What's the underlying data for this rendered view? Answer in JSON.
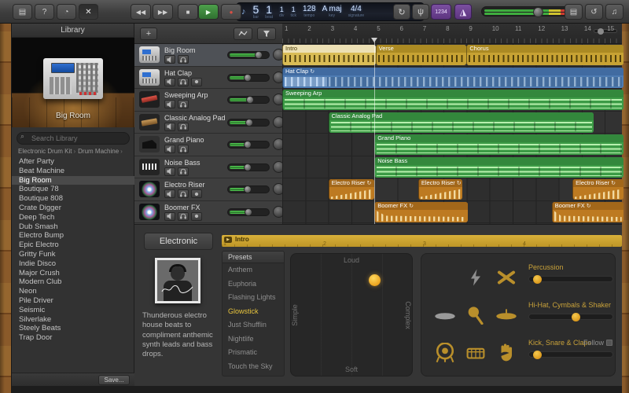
{
  "colors": {
    "accent_yellow": "#e8c53d",
    "region_yellow": "#c7a233",
    "region_blue": "#4e7cb3",
    "region_green": "#3c9b46",
    "region_orange": "#bd7a21",
    "play_green": "#3e8e41",
    "record_red": "#d94f44",
    "countin_purple": "#7b4fa0"
  },
  "toolbar": {
    "left_buttons": [
      {
        "name": "library-toggle-button",
        "glyph": "▤"
      },
      {
        "name": "quick-help-button",
        "glyph": "?"
      },
      {
        "name": "touch-instrument-button",
        "glyph": "◔"
      },
      {
        "name": "smart-controls-button",
        "glyph": "✕",
        "selected": true
      }
    ],
    "transport": {
      "rewind": "◀◀",
      "forward": "▶▶",
      "stop": "■",
      "play": "▶",
      "record": "●"
    },
    "cycle_glyph": "↻",
    "tuner_glyph": "ψ",
    "countin_label": "1234",
    "right_buttons": [
      {
        "name": "notepad-button",
        "glyph": "▤"
      },
      {
        "name": "loop-browser-button",
        "glyph": "↺"
      },
      {
        "name": "media-browser-button",
        "glyph": "♫"
      }
    ],
    "meter_level": 0.62
  },
  "lcd": {
    "icon": "♪",
    "fields": [
      {
        "label": "bar",
        "value": "5",
        "big": true
      },
      {
        "label": "beat",
        "value": "1",
        "big": true
      },
      {
        "label": "div",
        "value": "1"
      },
      {
        "label": "tick",
        "value": "1"
      },
      {
        "label": "tempo",
        "value": "128"
      },
      {
        "label": "key",
        "value": "A maj"
      },
      {
        "label": "signature",
        "value": "4/4"
      }
    ]
  },
  "library": {
    "title": "Library",
    "instrument_name": "Big Room",
    "search_placeholder": "Search Library",
    "breadcrumb": [
      "Electronic Drum Kit",
      "Drum Machine"
    ],
    "items": [
      "After Party",
      "Beat Machine",
      "Big Room",
      "Boutique 78",
      "Boutique 808",
      "Crate Digger",
      "Deep Tech",
      "Dub Smash",
      "Electro Bump",
      "Epic Electro",
      "Gritty Funk",
      "Indie Disco",
      "Major Crush",
      "Modern Club",
      "Neon",
      "Pile Driver",
      "Seismic",
      "Silverlake",
      "Steely Beats",
      "Trap Door"
    ],
    "selected_item": "Big Room",
    "save_label": "Save..."
  },
  "tracks": [
    {
      "name": "Big Room",
      "icon": "drum-machine",
      "selected": true,
      "volume": 0.78,
      "extra_button": false
    },
    {
      "name": "Hat Clap",
      "icon": "drum-machine",
      "selected": false,
      "volume": 0.45,
      "extra_button": true
    },
    {
      "name": "Sweeping Arp",
      "icon": "keyboard-red",
      "selected": false,
      "volume": 0.52,
      "extra_button": false
    },
    {
      "name": "Classic Analog Pad",
      "icon": "keyboard-wood",
      "selected": false,
      "volume": 0.5,
      "extra_button": false
    },
    {
      "name": "Grand Piano",
      "icon": "grand-piano",
      "selected": false,
      "volume": 0.45,
      "extra_button": false
    },
    {
      "name": "Noise Bass",
      "icon": "synth",
      "selected": false,
      "volume": 0.45,
      "extra_button": false
    },
    {
      "name": "Electro Riser",
      "icon": "sparkle",
      "selected": false,
      "volume": 0.45,
      "extra_button": true
    },
    {
      "name": "Boomer FX",
      "icon": "sparkle",
      "selected": false,
      "volume": 0.48,
      "extra_button": true
    }
  ],
  "timeline": {
    "bars_visible": 15,
    "playhead_bar": 5,
    "regions": [
      {
        "track": 0,
        "label": "Intro",
        "color": "yellow",
        "start": 1,
        "end": 5.05,
        "selected": true,
        "loop": false,
        "pattern": "ticks"
      },
      {
        "track": 0,
        "label": "Verse",
        "color": "yellow",
        "start": 5.05,
        "end": 9,
        "loop": false,
        "pattern": "ticks"
      },
      {
        "track": 0,
        "label": "Chorus",
        "color": "yellow",
        "start": 9,
        "end": 15.8,
        "loop": false,
        "pattern": "ticks"
      },
      {
        "track": 1,
        "label": "Hat Clap",
        "color": "blue",
        "start": 1,
        "end": 15.8,
        "loop": true,
        "pattern": "wave"
      },
      {
        "track": 2,
        "label": "Sweeping Arp",
        "color": "green",
        "start": 1,
        "end": 15.8,
        "loop": false,
        "pattern": "midi"
      },
      {
        "track": 3,
        "label": "Classic Analog Pad",
        "color": "green",
        "start": 3,
        "end": 14.5,
        "loop": false,
        "pattern": "midi"
      },
      {
        "track": 4,
        "label": "Grand Piano",
        "color": "green",
        "start": 5,
        "end": 15.8,
        "loop": false,
        "pattern": "midi"
      },
      {
        "track": 5,
        "label": "Noise Bass",
        "color": "green",
        "start": 5,
        "end": 15.8,
        "loop": false,
        "pattern": "midi"
      },
      {
        "track": 6,
        "label": "Electro Riser",
        "color": "orange",
        "start": 3,
        "end": 5,
        "loop": true,
        "pattern": "riser"
      },
      {
        "track": 6,
        "label": "Electro Riser",
        "color": "orange",
        "start": 6.9,
        "end": 8.8,
        "loop": true,
        "pattern": "riser"
      },
      {
        "track": 6,
        "label": "Electro Riser",
        "color": "orange",
        "start": 13.6,
        "end": 15.8,
        "loop": true,
        "pattern": "riser"
      },
      {
        "track": 7,
        "label": "Boomer FX",
        "color": "orange",
        "start": 5,
        "end": 9.05,
        "loop": true,
        "pattern": "boom"
      },
      {
        "track": 7,
        "label": "Boomer FX",
        "color": "orange",
        "start": 12.7,
        "end": 15.8,
        "loop": true,
        "pattern": "boom"
      }
    ],
    "loop_glyph": "↻"
  },
  "bottom": {
    "genre_label": "Electronic",
    "description": "Thunderous electro house beats to compliment anthemic synth leads and bass drops.",
    "section": {
      "label": "Intro",
      "ruler_numbers": [
        "1",
        "2",
        "3",
        "4"
      ]
    },
    "presets": {
      "header": "Presets",
      "items": [
        "Anthem",
        "Euphoria",
        "Flashing Lights",
        "Glowstick",
        "Just Shufflin",
        "Nightlife",
        "Prismatic",
        "Touch the Sky"
      ],
      "selected": "Glowstick"
    },
    "xy_pad": {
      "top": "Loud",
      "bottom": "Soft",
      "left": "Simple",
      "right": "Complex",
      "puck_x": 0.7,
      "puck_y": 0.18
    },
    "drum_rows": [
      {
        "label": "Percussion",
        "icons": [
          "lightning",
          "crossed-sticks"
        ],
        "value": 0.05,
        "follow": false
      },
      {
        "label": "Hi-Hat, Cymbals & Shaker",
        "icons": [
          "hihat-disc",
          "maraca",
          "cymbal"
        ],
        "value": 0.57,
        "follow": false
      },
      {
        "label": "Kick, Snare & Claps",
        "icons": [
          "kick-drum",
          "snare-drum",
          "clap-hand"
        ],
        "value": 0.05,
        "follow": true
      }
    ],
    "follow_label": "Follow"
  }
}
